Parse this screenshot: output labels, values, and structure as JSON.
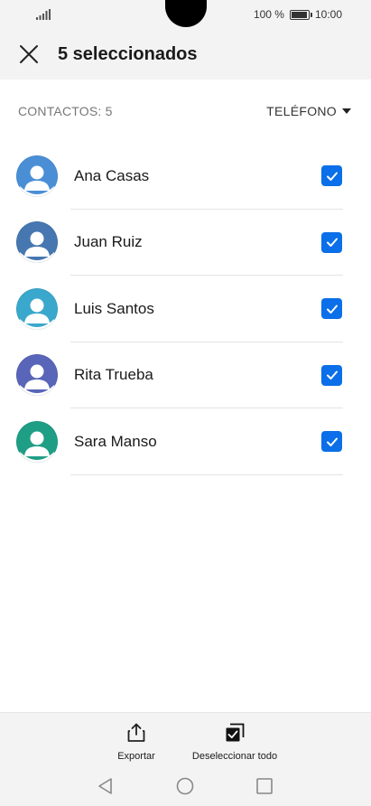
{
  "status": {
    "battery_percent_text": "100 %",
    "battery_level": 1.0,
    "time": "10:00"
  },
  "toolbar": {
    "title": "5 seleccionados",
    "close_icon": "close-icon"
  },
  "list": {
    "count_label": "CONTACTOS: 5",
    "sort_label": "TELÉFONO",
    "contacts": [
      {
        "name": "Ana Casas",
        "checked": true,
        "avatar_color": "#4a8fd6"
      },
      {
        "name": "Juan Ruiz",
        "checked": true,
        "avatar_color": "#4677b0"
      },
      {
        "name": "Luis Santos",
        "checked": true,
        "avatar_color": "#3aa8cc"
      },
      {
        "name": "Rita Trueba",
        "checked": true,
        "avatar_color": "#5865b8"
      },
      {
        "name": "Sara Manso",
        "checked": true,
        "avatar_color": "#1f9e86"
      }
    ]
  },
  "actions": {
    "export_label": "Exportar",
    "deselect_label": "Deseleccionar todo"
  },
  "colors": {
    "accent": "#0a6fe8",
    "background": "#f3f3f3",
    "surface": "#ffffff"
  },
  "icons": [
    "signal-icon",
    "battery-icon",
    "close-icon",
    "caret-down-icon",
    "avatar-icon",
    "checkbox-checked-icon",
    "share-icon",
    "deselect-all-icon",
    "nav-back-icon",
    "nav-home-icon",
    "nav-recents-icon"
  ]
}
